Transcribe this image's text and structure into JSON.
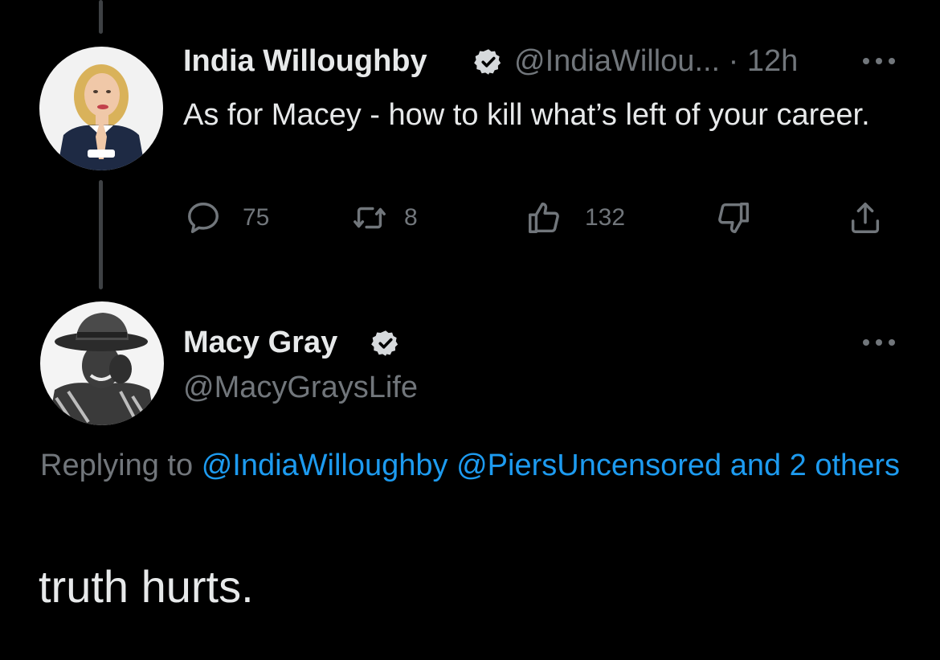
{
  "tweet": {
    "author_name": "India Willoughby",
    "handle_time": "@IndiaWillou... · 12h",
    "text": "As for Macey - how to kill what’s left of your career.",
    "reply_count": "75",
    "retweet_count": "8",
    "like_count": "132",
    "avatar_icon": "avatar-photo-india",
    "icons": {
      "reply": "speech-bubble-icon",
      "retweet": "retweet-icon",
      "like": "thumbs-up-icon",
      "dislike": "thumbs-down-icon",
      "share": "share-icon",
      "more": "more-options-icon",
      "verified": "verified-badge-icon"
    }
  },
  "reply": {
    "author_name": "Macy Gray",
    "handle": "@MacyGraysLife",
    "replying_prefix": "Replying to",
    "mention_1": "@IndiaWilloughby",
    "mention_2": "@PiersUncensored",
    "and_others": "and 2 others",
    "text": "truth hurts.",
    "avatar_icon": "avatar-photo-macy"
  },
  "colors": {
    "background": "#000000",
    "primary_text": "#e7e9ea",
    "secondary_text": "#71767b",
    "link": "#1d9bf0",
    "thread_line": "#3e4144"
  }
}
